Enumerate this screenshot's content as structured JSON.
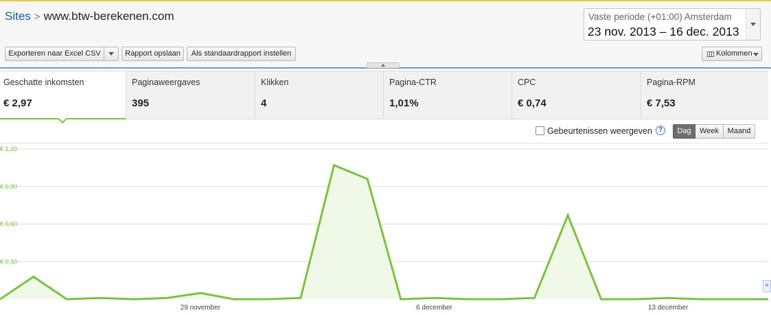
{
  "breadcrumb": {
    "root": "Sites",
    "separator": ">",
    "current": "www.btw-berekenen.com"
  },
  "date_range": {
    "label": "Vaste periode (+01:00) Amsterdam",
    "range": "23 nov. 2013 – 16 dec. 2013",
    "icon": "chevron-down-icon"
  },
  "toolbar": {
    "export_label": "Exporteren naar Excel CSV",
    "save_label": "Rapport opslaan",
    "default_label": "Als standaardrapport instellen",
    "columns_label": "Kolommen",
    "columns_icon": "columns-icon"
  },
  "metrics": [
    {
      "label": "Geschatte inkomsten",
      "value": "€ 2,97",
      "active": true
    },
    {
      "label": "Paginaweergaves",
      "value": "395",
      "active": false
    },
    {
      "label": "Klikken",
      "value": "4",
      "active": false
    },
    {
      "label": "Pagina-CTR",
      "value": "1,01%",
      "active": false
    },
    {
      "label": "CPC",
      "value": "€ 0,74",
      "active": false
    },
    {
      "label": "Pagina-RPM",
      "value": "€ 7,53",
      "active": false
    }
  ],
  "events_toggle": {
    "label": "Gebeurtenissen weergeven",
    "checked": false,
    "help_icon": "help-icon"
  },
  "granularity": {
    "options": [
      "Dag",
      "Week",
      "Maand"
    ],
    "selected": "Dag"
  },
  "colors": {
    "accent_green": "#7bc243",
    "area_fill": "#f0f8e8",
    "link_blue": "#1a56a8",
    "divider_blue": "#7a95c8"
  },
  "chart_data": {
    "type": "area",
    "title": "",
    "xlabel": "",
    "ylabel": "",
    "x": [
      "2013-11-23",
      "2013-11-24",
      "2013-11-25",
      "2013-11-26",
      "2013-11-27",
      "2013-11-28",
      "2013-11-29",
      "2013-11-30",
      "2013-12-01",
      "2013-12-02",
      "2013-12-03",
      "2013-12-04",
      "2013-12-05",
      "2013-12-06",
      "2013-12-07",
      "2013-12-08",
      "2013-12-09",
      "2013-12-10",
      "2013-12-11",
      "2013-12-12",
      "2013-12-13",
      "2013-12-14",
      "2013-12-15",
      "2013-12-16"
    ],
    "series": [
      {
        "name": "",
        "values": [
          0.0,
          0.18,
          0.0,
          0.01,
          0.0,
          0.01,
          0.05,
          0.0,
          0.0,
          0.01,
          1.07,
          0.96,
          0.0,
          0.01,
          0.0,
          0.0,
          0.01,
          0.67,
          0.0,
          0.0,
          0.01,
          0.0,
          0.0,
          0.0
        ]
      }
    ],
    "ylim": [
      0,
      1.2
    ],
    "yticks": [
      "€ 0,30",
      "€ 0,60",
      "€ 0,90",
      "€ 1,20"
    ],
    "ytick_values": [
      0.3,
      0.6,
      0.9,
      1.2
    ],
    "xticks": [
      "29 november",
      "6 december",
      "13 december"
    ],
    "xtick_indices": [
      6,
      13,
      20
    ],
    "grid": true,
    "legend": "none"
  }
}
